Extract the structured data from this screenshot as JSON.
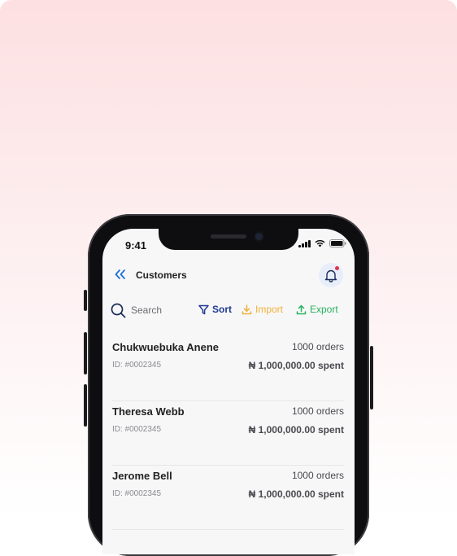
{
  "status_bar": {
    "time": "9:41"
  },
  "header": {
    "title": "Customers"
  },
  "toolbar": {
    "search_label": "Search",
    "sort_label": "Sort",
    "import_label": "Import",
    "export_label": "Export"
  },
  "colors": {
    "accent_blue": "#1f3a93",
    "import_orange": "#f0b13a",
    "export_green": "#27b35b",
    "notification_dot": "#e0334f"
  },
  "customers": [
    {
      "name": "Chukwuebuka Anene",
      "orders": "1000 orders",
      "id": "ID: #0002345",
      "spent": "₦ 1,000,000.00 spent"
    },
    {
      "name": "Theresa Webb",
      "orders": "1000 orders",
      "id": "ID: #0002345",
      "spent": "₦ 1,000,000.00 spent"
    },
    {
      "name": "Jerome Bell",
      "orders": "1000 orders",
      "id": "ID: #0002345",
      "spent": "₦ 1,000,000.00 spent"
    }
  ]
}
